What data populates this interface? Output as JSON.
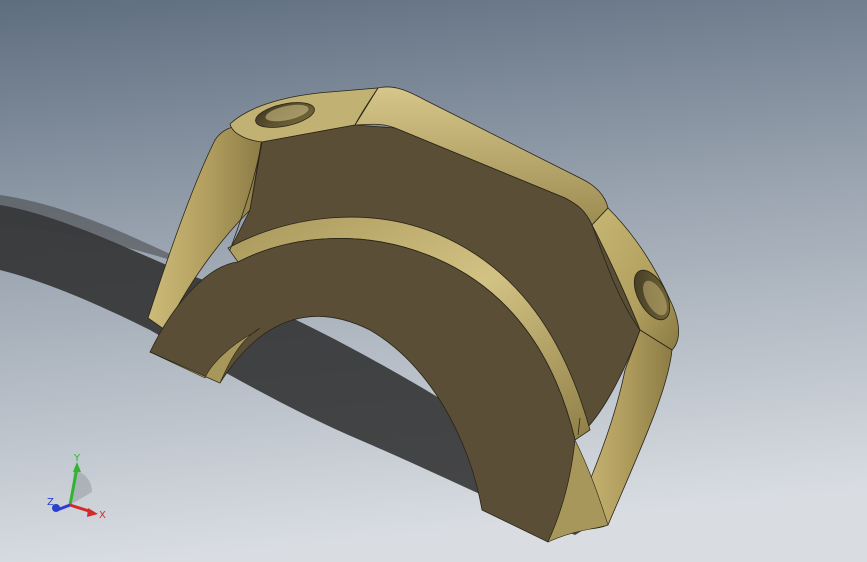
{
  "viewport": {
    "background_top": "#5f6e80",
    "background_bottom": "#d6dbe0",
    "model_color": "#b9a766",
    "model_highlight": "#d8c98c",
    "model_shadow": "#6e6238",
    "face_color": "#5a4f36",
    "edge_color": "#2a2518"
  },
  "triad": {
    "x_label": "X",
    "y_label": "Y",
    "z_label": "Z",
    "x_color": "#d22b2b",
    "y_color": "#2fb52f",
    "z_color": "#2b3fd2"
  }
}
